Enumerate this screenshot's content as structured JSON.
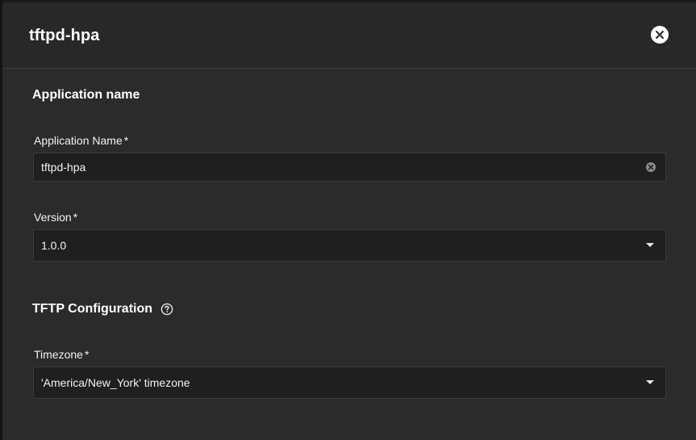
{
  "dialog": {
    "title": "tftpd-hpa",
    "close_icon": "close-icon"
  },
  "sections": {
    "app_name": {
      "title": "Application name",
      "name_field": {
        "label": "Application Name",
        "required_mark": "*",
        "value": "tftpd-hpa",
        "clear_icon": "clear-icon"
      },
      "version_field": {
        "label": "Version",
        "required_mark": "*",
        "value": "1.0.0",
        "caret_icon": "chevron-down-icon"
      }
    },
    "tftp": {
      "title": "TFTP Configuration",
      "help_icon": "help-icon",
      "timezone_field": {
        "label": "Timezone",
        "required_mark": "*",
        "value": "'America/New_York' timezone",
        "caret_icon": "chevron-down-icon"
      }
    }
  },
  "colors": {
    "dialog_bg": "#2b2b2b",
    "field_bg": "#1f1f1f",
    "text": "#f2f2f2"
  }
}
